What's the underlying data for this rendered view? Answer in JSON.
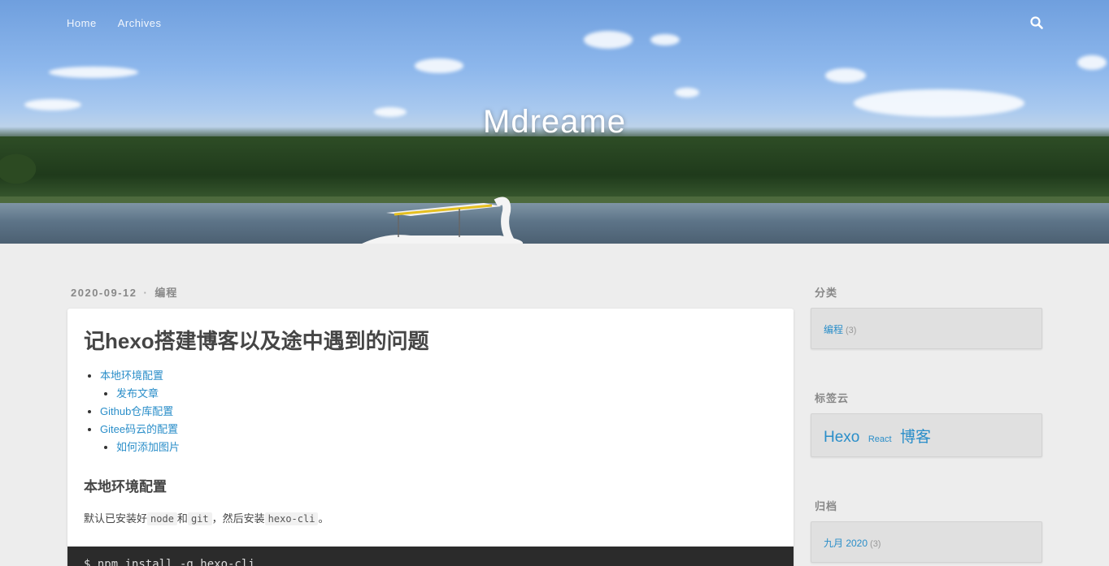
{
  "nav": {
    "items": [
      "Home",
      "Archives"
    ]
  },
  "icons": {
    "search": "search-icon"
  },
  "site": {
    "title": "Mdreame"
  },
  "post": {
    "date": "2020-09-12",
    "separator": "·",
    "category": "编程",
    "title": "记hexo搭建博客以及途中遇到的问题",
    "toc": [
      {
        "label": "本地环境配置",
        "children": [
          "发布文章"
        ]
      },
      {
        "label": "Github仓库配置",
        "children": []
      },
      {
        "label": "Gitee码云的配置",
        "children": [
          "如何添加图片"
        ]
      }
    ],
    "section_heading": "本地环境配置",
    "paragraph": {
      "prefix": "默认已安装好",
      "code1": "node",
      "mid1": "和",
      "code2": "git",
      "mid2": "，然后安装",
      "code3": "hexo-cli",
      "suffix": "。"
    },
    "code_block": "$ npm install -g hexo-cli"
  },
  "sidebar": {
    "categories": {
      "heading": "分类",
      "items": [
        {
          "label": "编程",
          "count": "(3)"
        }
      ]
    },
    "tags": {
      "heading": "标签云",
      "items": [
        {
          "label": "Hexo",
          "size": "large"
        },
        {
          "label": "React",
          "size": "small"
        },
        {
          "label": "博客",
          "size": "large"
        }
      ]
    },
    "archive": {
      "heading": "归档",
      "items": [
        {
          "label": "九月 2020",
          "count": "(3)"
        }
      ]
    }
  },
  "colors": {
    "link": "#2a8ec9",
    "background": "#ededed",
    "card": "#ffffff",
    "code_bg": "#2b2b2b"
  }
}
